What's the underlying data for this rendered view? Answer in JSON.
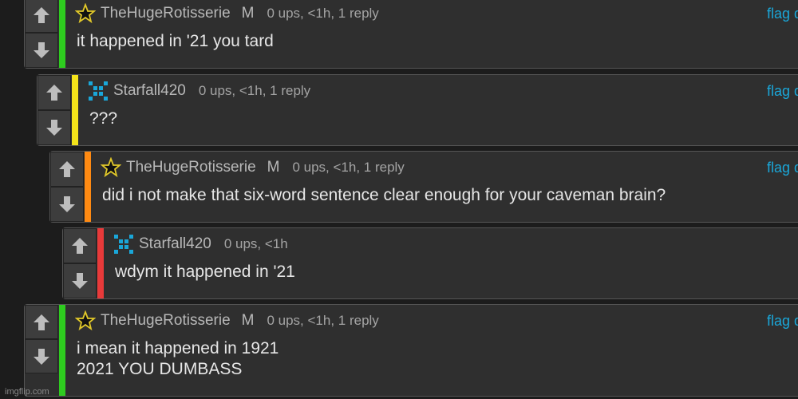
{
  "comments": [
    {
      "username": "TheHugeRotisserie",
      "badge": "M",
      "meta": "0 ups, <1h, 1 reply",
      "flag": "flag d",
      "text": "it happened in '21 you tard",
      "stripe": "#2ecc1f",
      "avatar": "star-icon"
    },
    {
      "username": "Starfall420",
      "badge": "",
      "meta": "0 ups, <1h, 1 reply",
      "flag": "flag d",
      "text": "???",
      "stripe": "#f4e41a",
      "avatar": "pixel-avatar-icon"
    },
    {
      "username": "TheHugeRotisserie",
      "badge": "M",
      "meta": "0 ups, <1h, 1 reply",
      "flag": "flag d",
      "text": "did i not make that six-word sentence clear enough for your caveman brain?",
      "stripe": "#ff8a12",
      "avatar": "star-icon"
    },
    {
      "username": "Starfall420",
      "badge": "",
      "meta": "0 ups, <1h",
      "flag": "",
      "text": "wdym it happened in '21",
      "stripe": "#e83a3a",
      "avatar": "pixel-avatar-icon"
    },
    {
      "username": "TheHugeRotisserie",
      "badge": "M",
      "meta": "0 ups, <1h, 1 reply",
      "flag": "flag d",
      "text": "i mean it happened in 1921\n2021 YOU DUMBASS",
      "stripe": "#2ecc1f",
      "avatar": "star-icon"
    }
  ],
  "watermark": "imgflip.com",
  "colors": {
    "background": "#1c1c1c",
    "comment": "#2f2f2f",
    "flag": "#1aa7d9",
    "pixel_avatar": "#1aa7d9"
  }
}
